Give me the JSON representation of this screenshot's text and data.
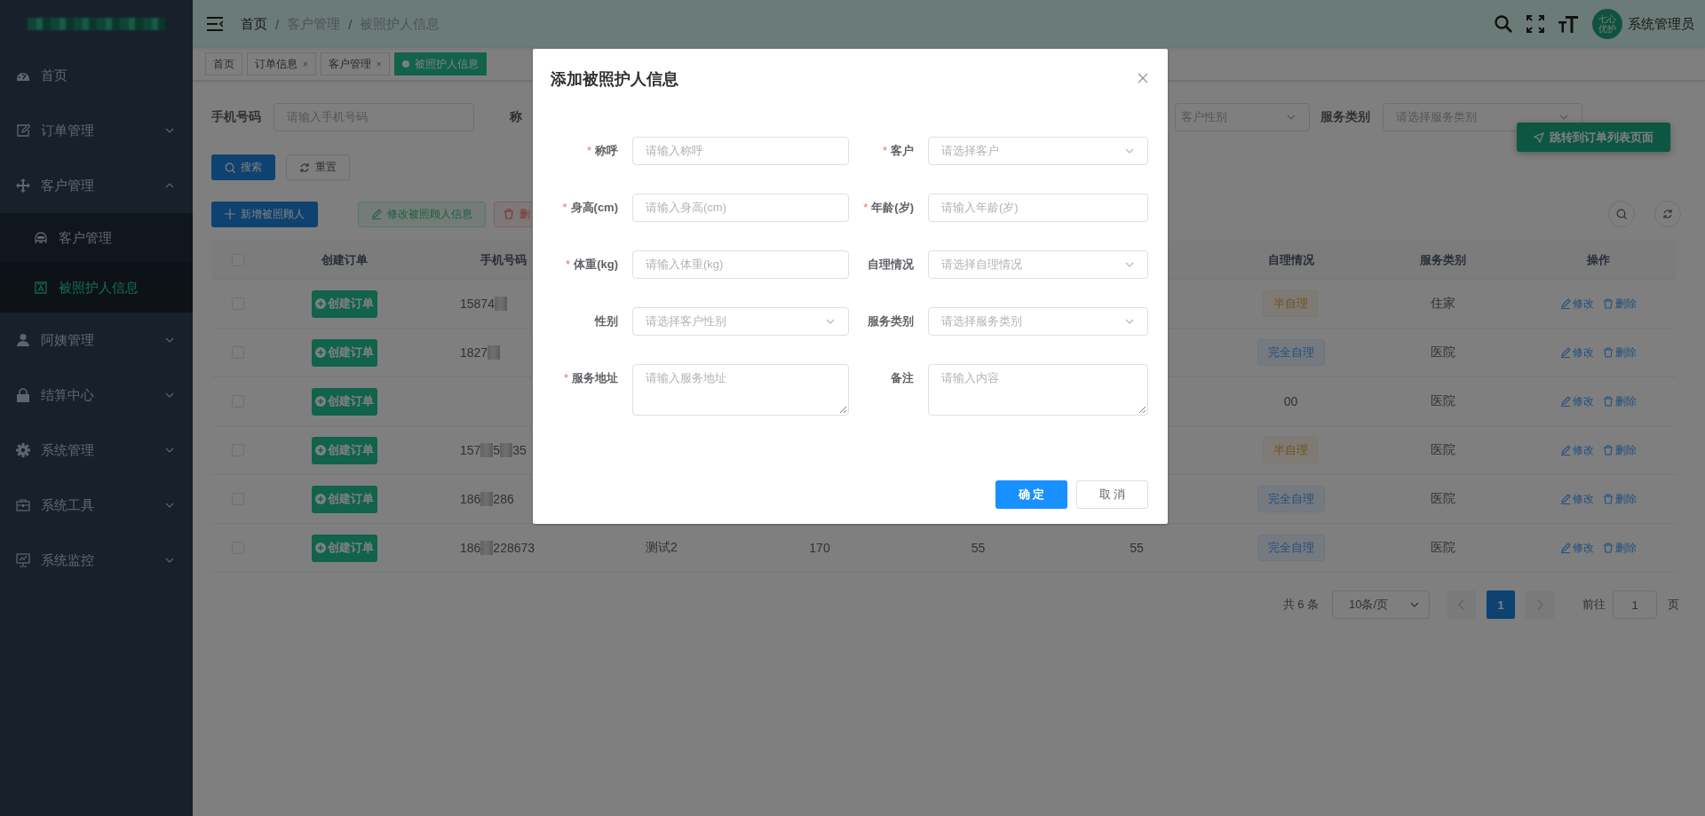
{
  "sidebar": {
    "items": [
      {
        "label": "首页",
        "selected": false
      },
      {
        "label": "订单管理",
        "expanded": false,
        "selected": false
      },
      {
        "label": "客户管理",
        "expanded": true,
        "selected": false,
        "children": [
          {
            "label": "客户管理",
            "selected": false
          },
          {
            "label": "被照护人信息",
            "selected": true
          }
        ]
      },
      {
        "label": "阿姨管理",
        "expanded": false,
        "selected": false
      },
      {
        "label": "结算中心",
        "expanded": false,
        "selected": false
      },
      {
        "label": "系统管理",
        "expanded": false,
        "selected": false
      },
      {
        "label": "系统工具",
        "expanded": false,
        "selected": false
      },
      {
        "label": "系统监控",
        "expanded": false,
        "selected": false
      }
    ]
  },
  "header": {
    "breadcrumb": [
      "首页",
      "客户管理",
      "被照护人信息"
    ],
    "separator": "/",
    "avatar_text": "七心优护",
    "user_name": "系统管理员"
  },
  "tags": [
    {
      "label": "首页",
      "selected": false
    },
    {
      "label": "订单信息",
      "close": "×",
      "selected": false
    },
    {
      "label": "客户管理",
      "close": "×",
      "selected": false
    },
    {
      "label": "被照护人信息",
      "selected": true
    }
  ],
  "search": {
    "phone_label": "手机号码",
    "phone_placeholder": "请输入手机号码",
    "name_label": "称",
    "gender_placeholder": "客户性别",
    "service_label": "服务类别",
    "service_placeholder": "请选择服务类别",
    "search_button": "搜索",
    "reset_button": "重置",
    "jump_button": "跳转到订单列表页面"
  },
  "toolbar": {
    "buttons": [
      {
        "kind": "add",
        "label": "新增被照顾人",
        "disabled": false
      },
      {
        "kind": "edit",
        "label": "修改被照顾人信息",
        "disabled": true
      },
      {
        "kind": "delete",
        "label": "删",
        "disabled": true
      }
    ]
  },
  "table": {
    "select_all_checked": false,
    "columns": {
      "create": "创建订单",
      "phone": "手机号码",
      "self_care": "自理情况",
      "service": "服务类别",
      "actions": "操作"
    },
    "rows": [
      {
        "checked": false,
        "create": "创建订单",
        "phone": [
          "15874"
        ],
        "self_care": {
          "kind": "half",
          "text": "半自理"
        },
        "service": "住家",
        "edit": "修改",
        "delete": "删除"
      },
      {
        "checked": false,
        "create": "创建订单",
        "phone": [
          "1827"
        ],
        "self_care": {
          "kind": "full",
          "text": "完全自理"
        },
        "service": "医院",
        "edit": "修改",
        "delete": "删除"
      },
      {
        "checked": false,
        "create": "创建订单",
        "phone": [],
        "self_care": {
          "kind": "plain",
          "text": "00"
        },
        "service": "医院",
        "edit": "修改",
        "delete": "删除"
      },
      {
        "checked": false,
        "create": "创建订单",
        "phone": [
          "157",
          "5",
          "35"
        ],
        "self_care": {
          "kind": "half",
          "text": "半自理"
        },
        "service": "医院",
        "edit": "修改",
        "delete": "删除"
      },
      {
        "checked": false,
        "create": "创建订单",
        "phone": [
          "186",
          "286"
        ],
        "self_care": {
          "kind": "full",
          "text": "完全自理"
        },
        "service": "医院",
        "edit": "修改",
        "delete": "删除"
      },
      {
        "checked": false,
        "create": "创建订单",
        "phone": [
          "186",
          "228673"
        ],
        "column_4": "测试2",
        "column_5": "170",
        "column_6": "55",
        "column_7": "55",
        "self_care": {
          "kind": "full",
          "text": "完全自理"
        },
        "service": "医院",
        "edit": "修改",
        "delete": "删除"
      }
    ]
  },
  "pagination": {
    "total": "共 6 条",
    "page_size": "10条/页",
    "pages": [
      {
        "label": "1",
        "selected": true
      }
    ],
    "goto_label": "前往",
    "goto_value": "1",
    "goto_suffix": "页"
  },
  "dialog": {
    "title": "添加被照护人信息",
    "required_mark": "*",
    "fields": [
      {
        "label": "称呼",
        "required": true,
        "kind": "input",
        "placeholder": "请输入称呼"
      },
      {
        "label": "客户",
        "required": true,
        "kind": "select",
        "placeholder": "请选择客户"
      },
      {
        "label": "身高(cm)",
        "required": true,
        "kind": "input",
        "placeholder": "请输入身高(cm)"
      },
      {
        "label": "年龄(岁)",
        "required": true,
        "kind": "input",
        "placeholder": "请输入年龄(岁)"
      },
      {
        "label": "体重(kg)",
        "required": true,
        "kind": "input",
        "placeholder": "请输入体重(kg)"
      },
      {
        "label": "自理情况",
        "required": false,
        "kind": "select",
        "placeholder": "请选择自理情况"
      },
      {
        "label": "性别",
        "required": false,
        "kind": "select",
        "placeholder": "请选择客户性别"
      },
      {
        "label": "服务类别",
        "required": false,
        "kind": "select",
        "placeholder": "请选择服务类别"
      },
      {
        "label": "服务地址",
        "required": true,
        "kind": "textarea",
        "placeholder": "请输入服务地址"
      },
      {
        "label": "备注",
        "required": false,
        "kind": "textarea",
        "placeholder": "请输入内容"
      }
    ],
    "confirm": "确 定",
    "cancel": "取 消"
  }
}
